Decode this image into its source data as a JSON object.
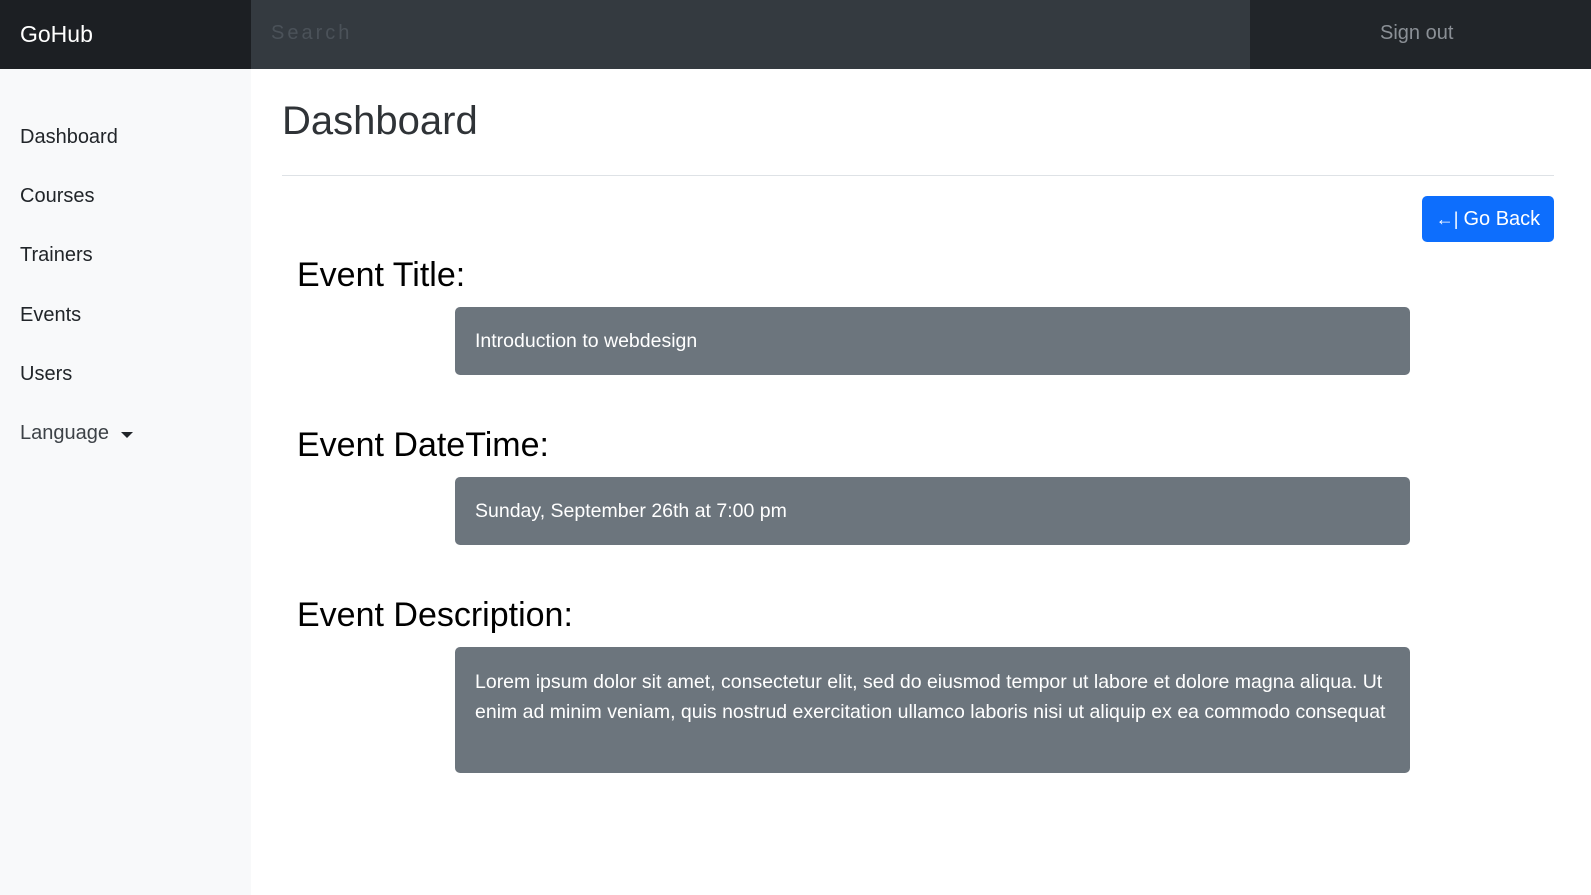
{
  "navbar": {
    "brand": "GoHub",
    "search_placeholder": "Search",
    "signout_label": "Sign out"
  },
  "sidebar": {
    "items": [
      {
        "label": "Dashboard"
      },
      {
        "label": "Courses"
      },
      {
        "label": "Trainers"
      },
      {
        "label": "Events"
      },
      {
        "label": "Users"
      },
      {
        "label": "Language"
      }
    ]
  },
  "main": {
    "title": "Dashboard",
    "go_back_icon": "←|",
    "go_back_label": "Go Back",
    "sections": [
      {
        "heading": "Event Title:",
        "value": "Introduction to webdesign"
      },
      {
        "heading": "Event DateTime:",
        "value": "Sunday, September 26th at 7:00 pm"
      },
      {
        "heading": "Event Description:",
        "value": "Lorem ipsum dolor sit amet, consectetur elit, sed do eiusmod tempor ut labore et dolore magna aliqua. Ut enim ad minim veniam, quis nostrud exercitation ullamco laboris nisi ut aliquip ex ea commodo consequat"
      }
    ]
  },
  "colors": {
    "navbar": "#212529",
    "search_bg": "#343a40",
    "sidebar_bg": "#f8f9fa",
    "primary": "#0d6efd",
    "value_box": "#6c757d"
  }
}
